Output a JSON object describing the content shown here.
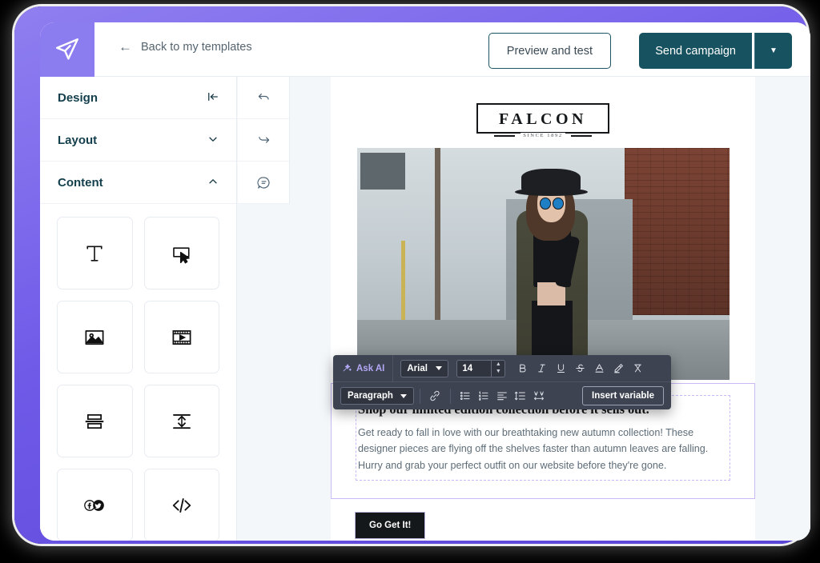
{
  "app": {
    "logo_icon": "paper-plane-icon",
    "back_label": "Back to my templates",
    "back_icon": "arrow-left-icon"
  },
  "header": {
    "preview_label": "Preview and test",
    "send_label": "Send campaign",
    "send_caret_icon": "chevron-down-icon"
  },
  "colors": {
    "frame_purple": "#6f5ae8",
    "logo_purple": "#8b7cf0",
    "send_teal": "#175260",
    "heading_teal": "#133f4d",
    "canvas_bg": "#f3f7fa",
    "toolbar_dark": "#3d4350",
    "ask_ai_purple": "#b3a7f5",
    "selection_purple": "#c9b9f4"
  },
  "sidebar": {
    "sections": [
      {
        "label": "Design",
        "icon": "collapse-panel-icon",
        "expanded": false
      },
      {
        "label": "Layout",
        "icon": "chevron-down-icon",
        "expanded": false
      },
      {
        "label": "Content",
        "icon": "chevron-up-icon",
        "expanded": true
      }
    ],
    "blocks": [
      {
        "name": "text-block",
        "icon": "text-t-icon"
      },
      {
        "name": "button-block",
        "icon": "cursor-button-icon"
      },
      {
        "name": "image-block",
        "icon": "image-icon"
      },
      {
        "name": "video-block",
        "icon": "film-strip-icon"
      },
      {
        "name": "divider-block",
        "icon": "divider-icon"
      },
      {
        "name": "spacer-block",
        "icon": "spacer-icon"
      },
      {
        "name": "social-block",
        "icon": "social-icons-icon"
      },
      {
        "name": "html-block",
        "icon": "code-icon"
      }
    ]
  },
  "minitoolbar": {
    "buttons": [
      {
        "name": "undo-button",
        "icon": "undo-icon"
      },
      {
        "name": "redo-button",
        "icon": "redo-icon"
      },
      {
        "name": "comment-button",
        "icon": "comment-icon"
      }
    ]
  },
  "email": {
    "logo_word": "FALCON",
    "logo_tagline": "SINCE 1892",
    "hero_alt": "woman-in-hat-and-sunglasses-street-photo",
    "headline": "Shop our limited edition collection before it sells out.",
    "body": "Get ready to fall in love with our breathtaking new autumn collection! These designer pieces are flying off the shelves faster than autumn leaves are falling. Hurry and grab your perfect outfit on our website before they're gone.",
    "cta_label": "Go Get It!"
  },
  "rich_toolbar": {
    "ask_ai_label": "Ask AI",
    "ask_ai_icon": "magic-wand-icon",
    "font_family": "Arial",
    "font_size": "14",
    "paragraph_style": "Paragraph",
    "insert_variable_label": "Insert variable",
    "format_buttons": [
      {
        "name": "bold-button",
        "label": "B",
        "icon": "bold-icon"
      },
      {
        "name": "italic-button",
        "label": "I",
        "icon": "italic-icon"
      },
      {
        "name": "underline-button",
        "label": "U",
        "icon": "underline-icon"
      },
      {
        "name": "strikethrough-button",
        "label": "S",
        "icon": "strikethrough-icon"
      },
      {
        "name": "font-color-button",
        "label": "A",
        "icon": "font-color-icon"
      },
      {
        "name": "highlight-button",
        "label": "",
        "icon": "highlighter-icon"
      },
      {
        "name": "clear-format-button",
        "label": "",
        "icon": "clear-formatting-icon"
      }
    ],
    "paragraph_buttons": [
      {
        "name": "link-button",
        "icon": "link-icon"
      },
      {
        "name": "bullet-list-button",
        "icon": "bullet-list-icon"
      },
      {
        "name": "numbered-list-button",
        "icon": "numbered-list-icon"
      },
      {
        "name": "align-button",
        "icon": "align-left-icon"
      },
      {
        "name": "line-height-button",
        "icon": "line-height-icon"
      },
      {
        "name": "letter-spacing-button",
        "icon": "letter-spacing-icon"
      }
    ]
  }
}
